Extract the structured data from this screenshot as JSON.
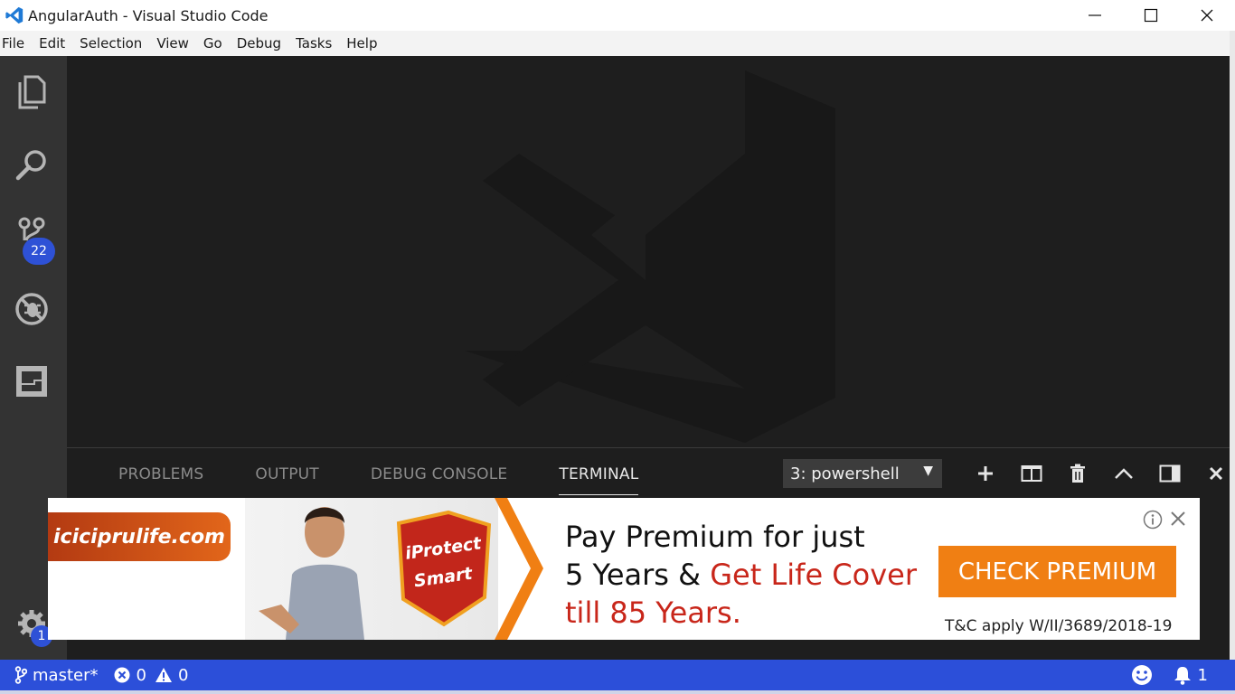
{
  "window": {
    "title": "AngularAuth - Visual Studio Code"
  },
  "menu": [
    "File",
    "Edit",
    "Selection",
    "View",
    "Go",
    "Debug",
    "Tasks",
    "Help"
  ],
  "activity_bar": {
    "items": [
      {
        "icon": "explorer-icon"
      },
      {
        "icon": "search-icon"
      },
      {
        "icon": "source-control-icon",
        "badge": "22"
      },
      {
        "icon": "debug-icon"
      },
      {
        "icon": "extensions-icon"
      }
    ],
    "settings_badge": "1"
  },
  "panel": {
    "tabs": [
      "PROBLEMS",
      "OUTPUT",
      "DEBUG CONSOLE",
      "TERMINAL"
    ],
    "active_tab": "TERMINAL",
    "terminal_select": "3: powershell",
    "actions": [
      "add-icon",
      "split-icon",
      "trash-icon",
      "chevron-up-icon",
      "panel-layout-icon",
      "close-icon"
    ]
  },
  "ad": {
    "brand": "iciciprulife.com",
    "badge_line1": "iProtect",
    "badge_line2": "Smart",
    "headline_1": "Pay Premium for just",
    "headline_2a": "5 Years & ",
    "headline_2b": "Get Life Cover",
    "headline_3": "till 85 Years.",
    "cta": "CHECK PREMIUM",
    "tc": "T&C apply W/II/3689/2018-19"
  },
  "status": {
    "branch": "master*",
    "errors": "0",
    "warnings": "0",
    "notifications": "1"
  },
  "colors": {
    "status_bar": "#2c4fd9",
    "activity_bar": "#333333",
    "editor_bg": "#1e1e1e",
    "cta": "#f07f13",
    "accent_red": "#c8261a"
  }
}
